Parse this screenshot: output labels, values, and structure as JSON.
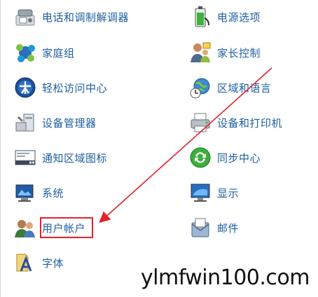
{
  "control_panel": {
    "items": [
      {
        "label": "电话和调制解调器",
        "icon": "phone-modem-icon"
      },
      {
        "label": "电源选项",
        "icon": "battery-icon"
      },
      {
        "label": "家庭组",
        "icon": "homegroup-icon"
      },
      {
        "label": "家长控制",
        "icon": "parental-controls-icon"
      },
      {
        "label": "轻松访问中心",
        "icon": "ease-of-access-icon"
      },
      {
        "label": "区域和语言",
        "icon": "globe-clock-icon"
      },
      {
        "label": "设备管理器",
        "icon": "device-manager-icon"
      },
      {
        "label": "设备和打印机",
        "icon": "printer-icon"
      },
      {
        "label": "通知区域图标",
        "icon": "notification-area-icon"
      },
      {
        "label": "同步中心",
        "icon": "sync-icon"
      },
      {
        "label": "系统",
        "icon": "system-icon"
      },
      {
        "label": "显示",
        "icon": "display-icon"
      },
      {
        "label": "用户帐户",
        "icon": "user-accounts-icon"
      },
      {
        "label": "邮件",
        "icon": "mail-icon"
      },
      {
        "label": "字体",
        "icon": "fonts-icon"
      }
    ]
  },
  "watermark": "ylmfwin100.com",
  "colors": {
    "link": "#1f5fa0",
    "annotation": "#e2232a"
  }
}
